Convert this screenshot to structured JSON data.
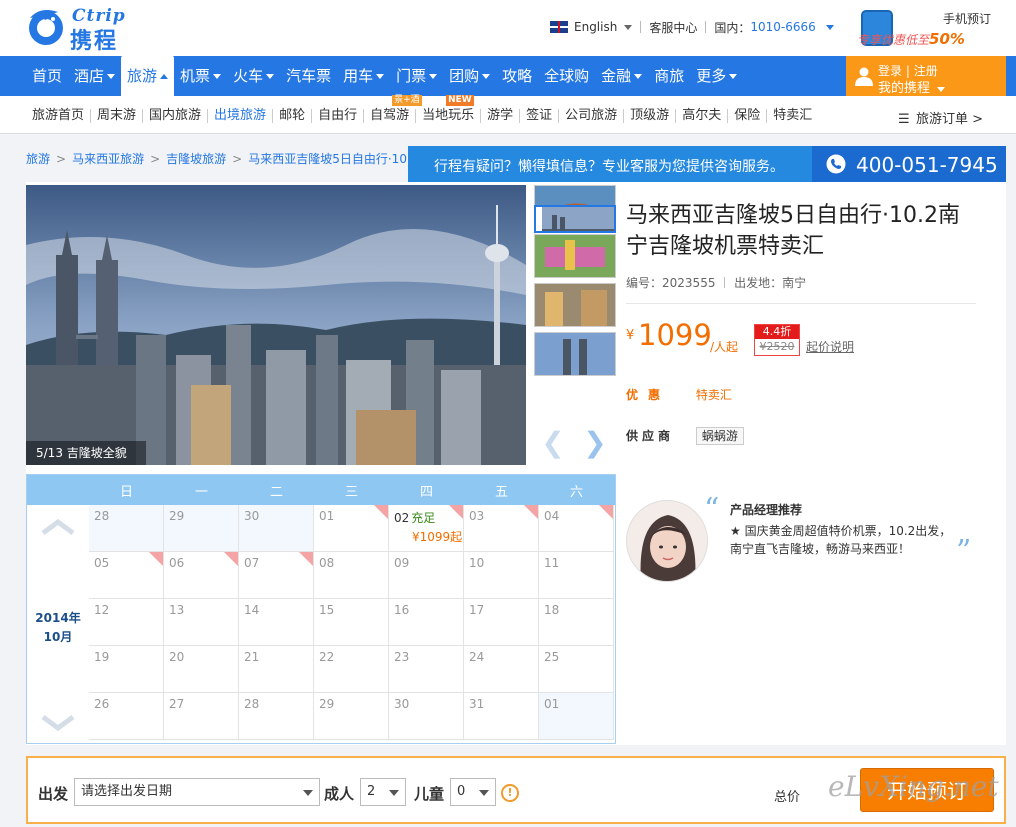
{
  "logo": {
    "en": "Ctrip",
    "cn": "携程"
  },
  "topbar": {
    "language": "English",
    "service_center": "客服中心",
    "domestic_label": "国内：",
    "hotline": "1010-6666",
    "app_title": "手机预订",
    "app_promo_prefix": "专享优惠低至",
    "app_promo_value": "50%"
  },
  "nav": {
    "items": [
      {
        "label": "首页",
        "dropdown": false
      },
      {
        "label": "酒店",
        "dropdown": true
      },
      {
        "label": "旅游",
        "dropdown": true,
        "active": true
      },
      {
        "label": "机票",
        "dropdown": true
      },
      {
        "label": "火车",
        "dropdown": true
      },
      {
        "label": "汽车票",
        "dropdown": false
      },
      {
        "label": "用车",
        "dropdown": true
      },
      {
        "label": "门票",
        "dropdown": true
      },
      {
        "label": "团购",
        "dropdown": true
      },
      {
        "label": "攻略",
        "dropdown": false
      },
      {
        "label": "全球购",
        "dropdown": false
      },
      {
        "label": "金融",
        "dropdown": true
      },
      {
        "label": "商旅",
        "dropdown": false
      },
      {
        "label": "更多",
        "dropdown": true
      }
    ],
    "login": "登录",
    "register": "注册",
    "my_ctrip": "我的携程"
  },
  "subnav": {
    "items": [
      {
        "label": "旅游首页"
      },
      {
        "label": "周末游"
      },
      {
        "label": "国内旅游"
      },
      {
        "label": "出境旅游",
        "current": true
      },
      {
        "label": "邮轮"
      },
      {
        "label": "自由行"
      },
      {
        "label": "自驾游",
        "tag": "景+酒"
      },
      {
        "label": "当地玩乐",
        "tag": "NEW"
      },
      {
        "label": "游学"
      },
      {
        "label": "签证"
      },
      {
        "label": "公司旅游"
      },
      {
        "label": "顶级游"
      },
      {
        "label": "高尔夫"
      },
      {
        "label": "保险"
      },
      {
        "label": "特卖汇"
      }
    ],
    "orders": "旅游订单 >"
  },
  "breadcrumb": [
    "旅游",
    "马来西亚旅游",
    "吉隆坡旅游",
    "马来西亚吉隆坡5日自由行·10.2南"
  ],
  "banner": {
    "question": "行程有疑问？懒得填信息？专业客服为您提供咨询服务。",
    "phone": "400-051-7945"
  },
  "gallery": {
    "caption": "5/13 吉隆坡全貌"
  },
  "product": {
    "title": "马来西亚吉隆坡5日自由行·10.2南宁吉隆坡机票特卖汇",
    "code_label": "编号：",
    "code": "2023555",
    "departure_label": "出发地：",
    "departure": "南宁",
    "price_symbol": "¥",
    "price": "1099",
    "price_unit": "/人起",
    "discount": "4.4折",
    "original_price": "¥2520",
    "price_note": "起价说明",
    "promo_label": "优惠",
    "promo_value": "特卖汇",
    "supplier_label": "供应商",
    "supplier": "蜗蜗游"
  },
  "calendar": {
    "year_label": "2014年",
    "month_label": "10月",
    "weekdays": [
      "日",
      "一",
      "二",
      "三",
      "四",
      "五",
      "六"
    ],
    "days": [
      {
        "d": "28",
        "tint": true
      },
      {
        "d": "29",
        "tint": true
      },
      {
        "d": "30",
        "tint": true
      },
      {
        "d": "01",
        "hui": true
      },
      {
        "d": "02",
        "hui": true,
        "status": "充足",
        "price": "¥1099起",
        "avail": true
      },
      {
        "d": "03",
        "hui": true
      },
      {
        "d": "04",
        "hui": true
      },
      {
        "d": "05",
        "hui": true
      },
      {
        "d": "06",
        "hui": true
      },
      {
        "d": "07",
        "hui": true
      },
      {
        "d": "08"
      },
      {
        "d": "09"
      },
      {
        "d": "10"
      },
      {
        "d": "11"
      },
      {
        "d": "12"
      },
      {
        "d": "13"
      },
      {
        "d": "14"
      },
      {
        "d": "15"
      },
      {
        "d": "16"
      },
      {
        "d": "17"
      },
      {
        "d": "18"
      },
      {
        "d": "19"
      },
      {
        "d": "20"
      },
      {
        "d": "21"
      },
      {
        "d": "22"
      },
      {
        "d": "23"
      },
      {
        "d": "24"
      },
      {
        "d": "25"
      },
      {
        "d": "26"
      },
      {
        "d": "27"
      },
      {
        "d": "28"
      },
      {
        "d": "29"
      },
      {
        "d": "30"
      },
      {
        "d": "31"
      },
      {
        "d": "01",
        "tint": true
      }
    ],
    "hui_label": "惠"
  },
  "manager": {
    "title": "产品经理推荐",
    "text": "★ 国庆黄金周超值特价机票，10.2出发，南宁直飞吉隆坡，畅游马来西亚！"
  },
  "booking": {
    "depart_label": "出发",
    "depart_placeholder": "请选择出发日期",
    "adult_label": "成人",
    "adult_value": "2",
    "child_label": "儿童",
    "child_value": "0",
    "total_label": "总价",
    "book_button": "开始预订",
    "watermark": "eLvXing.net"
  },
  "colors": {
    "brand_blue": "#2577e3",
    "login_orange": "#fc9818",
    "price_orange": "#f26e00"
  }
}
